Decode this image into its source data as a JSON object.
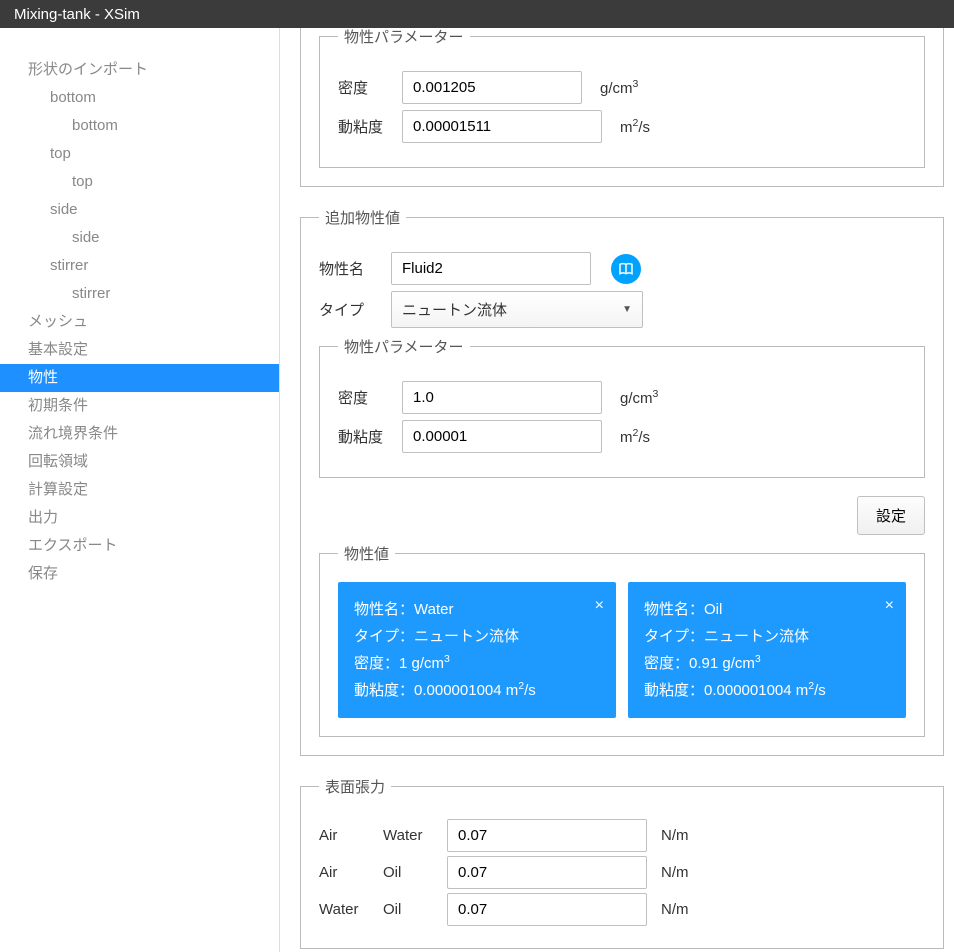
{
  "window": {
    "title": "Mixing-tank - XSim"
  },
  "sidebar": {
    "items": [
      {
        "label": "形状のインポート",
        "indent": 0
      },
      {
        "label": "bottom",
        "indent": 1
      },
      {
        "label": "bottom",
        "indent": 2
      },
      {
        "label": "top",
        "indent": 1
      },
      {
        "label": "top",
        "indent": 2
      },
      {
        "label": "side",
        "indent": 1
      },
      {
        "label": "side",
        "indent": 2
      },
      {
        "label": "stirrer",
        "indent": 1
      },
      {
        "label": "stirrer",
        "indent": 2
      },
      {
        "label": "メッシュ",
        "indent": 0
      },
      {
        "label": "基本設定",
        "indent": 0
      },
      {
        "label": "物性",
        "indent": 0,
        "selected": true
      },
      {
        "label": "初期条件",
        "indent": 0
      },
      {
        "label": "流れ境界条件",
        "indent": 0
      },
      {
        "label": "回転領域",
        "indent": 0
      },
      {
        "label": "計算設定",
        "indent": 0
      },
      {
        "label": "出力",
        "indent": 0
      },
      {
        "label": "エクスポート",
        "indent": 0
      },
      {
        "label": "保存",
        "indent": 0
      }
    ]
  },
  "top_partial": {
    "legend": "物性パラメーター",
    "density_label": "密度",
    "density_value": "0.001205",
    "density_unit": "g/cm³",
    "viscosity_label": "動粘度",
    "viscosity_value": "0.00001511",
    "viscosity_unit": "m²/s"
  },
  "add_props": {
    "legend": "追加物性値",
    "name_label": "物性名",
    "name_value": "Fluid2",
    "type_label": "タイプ",
    "type_value": "ニュートン流体",
    "params": {
      "legend": "物性パラメーター",
      "density_label": "密度",
      "density_value": "1.0",
      "density_unit": "g/cm³",
      "viscosity_label": "動粘度",
      "viscosity_value": "0.00001",
      "viscosity_unit": "m²/s"
    },
    "button": "設定"
  },
  "props_cards": {
    "legend": "物性値",
    "cards": [
      {
        "name": "物性名：Water",
        "type": "タイプ：ニュートン流体",
        "density": "密度：1 g/cm³",
        "viscosity": "動粘度：0.000001004 m²/s"
      },
      {
        "name": "物性名：Oil",
        "type": "タイプ：ニュートン流体",
        "density": "密度：0.91 g/cm³",
        "viscosity": "動粘度：0.000001004 m²/s"
      }
    ],
    "close": "×"
  },
  "tension": {
    "legend": "表面張力",
    "unit": "N/m",
    "rows": [
      {
        "p1": "Air",
        "p2": "Water",
        "value": "0.07"
      },
      {
        "p1": "Air",
        "p2": "Oil",
        "value": "0.07"
      },
      {
        "p1": "Water",
        "p2": "Oil",
        "value": "0.07"
      }
    ]
  }
}
